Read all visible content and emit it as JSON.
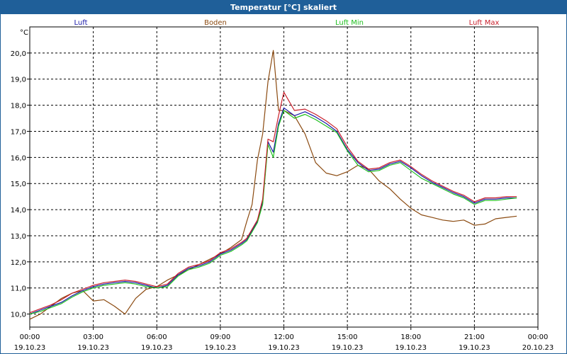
{
  "window": {
    "title": "Temperatur [°C] skaliert"
  },
  "colors": {
    "titlebar": "#1f5f99",
    "grid": "#000000",
    "series": [
      "#1a1aa8",
      "#8b4a10",
      "#1fbf1f",
      "#c81e2a"
    ]
  },
  "chart_data": {
    "type": "line",
    "title": "Temperatur [°C] skaliert",
    "ylabel": "°C",
    "xlabel": "",
    "ylim": [
      9.5,
      21.0
    ],
    "xlim": [
      "19.10.23 00:00",
      "20.10.23 00:00"
    ],
    "grid": true,
    "legend": "top",
    "y_ticks": [
      "10,0",
      "11,0",
      "12,0",
      "13,0",
      "14,0",
      "15,0",
      "16,0",
      "17,0",
      "18,0",
      "19,0",
      "20,0"
    ],
    "x_ticks": [
      {
        "time": "00:00",
        "date": "19.10.23"
      },
      {
        "time": "03:00",
        "date": "19.10.23"
      },
      {
        "time": "06:00",
        "date": "19.10.23"
      },
      {
        "time": "09:00",
        "date": "19.10.23"
      },
      {
        "time": "12:00",
        "date": "19.10.23"
      },
      {
        "time": "15:00",
        "date": "19.10.23"
      },
      {
        "time": "18:00",
        "date": "19.10.23"
      },
      {
        "time": "21:00",
        "date": "19.10.23"
      },
      {
        "time": "00:00",
        "date": "20.10.23"
      }
    ],
    "x_hours": [
      0,
      0.5,
      1,
      1.5,
      2,
      2.5,
      3,
      3.5,
      4,
      4.5,
      5,
      5.5,
      6,
      6.5,
      7,
      7.5,
      8,
      8.5,
      9,
      9.5,
      10,
      10.25,
      10.5,
      10.75,
      11,
      11.25,
      11.5,
      11.75,
      12,
      12.5,
      13,
      13.5,
      14,
      14.5,
      15,
      15.5,
      16,
      16.5,
      17,
      17.5,
      18,
      18.5,
      19,
      19.5,
      20,
      20.5,
      21,
      21.5,
      22,
      22.5,
      23,
      23.5,
      24
    ],
    "series": [
      {
        "name": "Luft",
        "values": [
          10.0,
          10.15,
          10.3,
          10.45,
          10.7,
          10.9,
          11.05,
          11.15,
          11.2,
          11.25,
          11.2,
          11.1,
          11.0,
          11.1,
          11.5,
          11.75,
          11.85,
          12.0,
          12.3,
          12.45,
          12.7,
          12.85,
          13.2,
          13.55,
          14.3,
          16.6,
          16.2,
          17.3,
          17.9,
          17.6,
          17.75,
          17.55,
          17.3,
          17.0,
          16.3,
          15.8,
          15.5,
          15.55,
          15.75,
          15.85,
          15.6,
          15.3,
          15.05,
          14.85,
          14.65,
          14.5,
          14.25,
          14.4,
          14.4,
          14.45,
          14.45
        ]
      },
      {
        "name": "Boden",
        "values": [
          9.8,
          10.0,
          10.3,
          10.6,
          10.8,
          10.9,
          10.5,
          10.55,
          10.3,
          10.0,
          10.6,
          10.95,
          11.05,
          11.3,
          11.5,
          11.7,
          11.9,
          12.1,
          12.3,
          12.55,
          12.85,
          13.55,
          14.2,
          15.9,
          16.9,
          18.9,
          20.1,
          17.8,
          17.8,
          17.6,
          16.9,
          15.8,
          15.4,
          15.3,
          15.45,
          15.7,
          15.55,
          15.1,
          14.8,
          14.4,
          14.05,
          13.8,
          13.7,
          13.6,
          13.55,
          13.6,
          13.4,
          13.45,
          13.65,
          13.7,
          13.75
        ]
      },
      {
        "name": "Luft Min",
        "values": [
          10.0,
          10.1,
          10.25,
          10.4,
          10.65,
          10.85,
          11.0,
          11.1,
          11.15,
          11.2,
          11.15,
          11.05,
          11.0,
          11.05,
          11.45,
          11.7,
          11.8,
          11.95,
          12.25,
          12.4,
          12.65,
          12.8,
          13.15,
          13.5,
          14.2,
          16.5,
          16.0,
          17.2,
          17.8,
          17.5,
          17.65,
          17.45,
          17.2,
          16.95,
          16.25,
          15.7,
          15.45,
          15.5,
          15.7,
          15.8,
          15.5,
          15.2,
          15.0,
          14.8,
          14.6,
          14.45,
          14.2,
          14.35,
          14.35,
          14.4,
          14.45
        ]
      },
      {
        "name": "Luft Max",
        "values": [
          10.05,
          10.2,
          10.35,
          10.55,
          10.8,
          10.95,
          11.1,
          11.2,
          11.25,
          11.3,
          11.25,
          11.15,
          11.05,
          11.15,
          11.55,
          11.8,
          11.9,
          12.05,
          12.35,
          12.5,
          12.75,
          12.9,
          13.25,
          13.6,
          14.4,
          16.7,
          16.6,
          17.6,
          18.5,
          17.8,
          17.85,
          17.65,
          17.4,
          17.1,
          16.4,
          15.85,
          15.55,
          15.6,
          15.8,
          15.9,
          15.65,
          15.35,
          15.1,
          14.9,
          14.7,
          14.55,
          14.3,
          14.45,
          14.45,
          14.5,
          14.5
        ]
      }
    ]
  }
}
